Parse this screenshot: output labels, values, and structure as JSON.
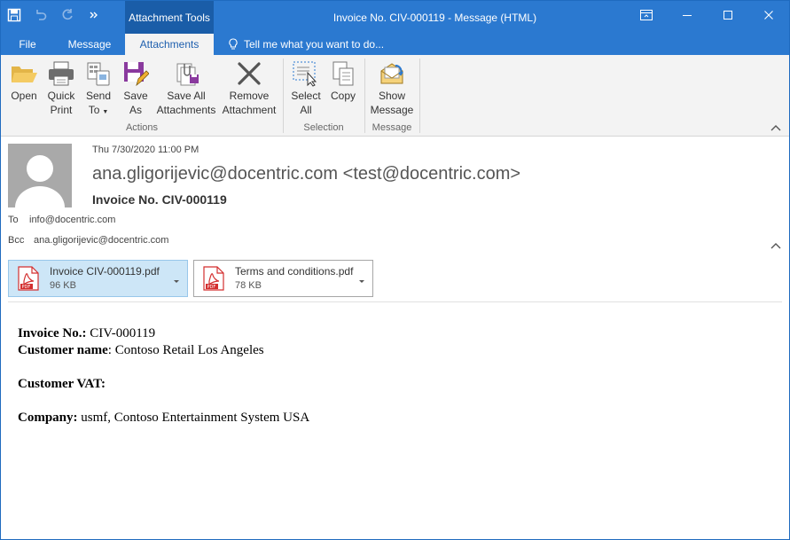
{
  "window": {
    "context_tab": "Attachment Tools",
    "title": "Invoice No. CIV-000119  -  Message (HTML)"
  },
  "tabs": [
    {
      "label": "File"
    },
    {
      "label": "Message"
    },
    {
      "label": "Attachments"
    }
  ],
  "tell_me": "Tell me what you want to do...",
  "ribbon": {
    "actions": {
      "open": "Open",
      "quick_print_1": "Quick",
      "quick_print_2": "Print",
      "send_to_1": "Send",
      "send_to_2": "To",
      "save_as_1": "Save",
      "save_as_2": "As",
      "save_all_1": "Save All",
      "save_all_2": "Attachments",
      "remove_1": "Remove",
      "remove_2": "Attachment",
      "group": "Actions"
    },
    "selection": {
      "select_all_1": "Select",
      "select_all_2": "All",
      "copy": "Copy",
      "group": "Selection"
    },
    "message": {
      "show_1": "Show",
      "show_2": "Message",
      "group": "Message"
    }
  },
  "header": {
    "datetime": "Thu 7/30/2020 11:00 PM",
    "from": "ana.gligorijevic@docentric.com <test@docentric.com>",
    "subject": "Invoice No. CIV-000119",
    "to_label": "To",
    "to_value": "info@docentric.com",
    "bcc_label": "Bcc",
    "bcc_value": "ana.gligorijevic@docentric.com"
  },
  "attachments": [
    {
      "name": "Invoice CIV-000119.pdf",
      "size": "96 KB",
      "icon": "pdf-icon"
    },
    {
      "name": "Terms and conditions.pdf",
      "size": "78 KB",
      "icon": "pdf-icon"
    }
  ],
  "body": {
    "invoice_label": "Invoice No.:",
    "invoice_value": " CIV-000119",
    "customer_label": "Customer name",
    "customer_value": ": Contoso Retail Los Angeles",
    "vat_label": "Customer VAT:",
    "company_label": "Company:",
    "company_value": " usmf, Contoso Entertainment System USA"
  },
  "colors": {
    "accent": "#2b79d0",
    "context_tab": "#1a5da8",
    "selected_attachment": "#cde6f7",
    "pdf_red": "#d32f2f"
  }
}
